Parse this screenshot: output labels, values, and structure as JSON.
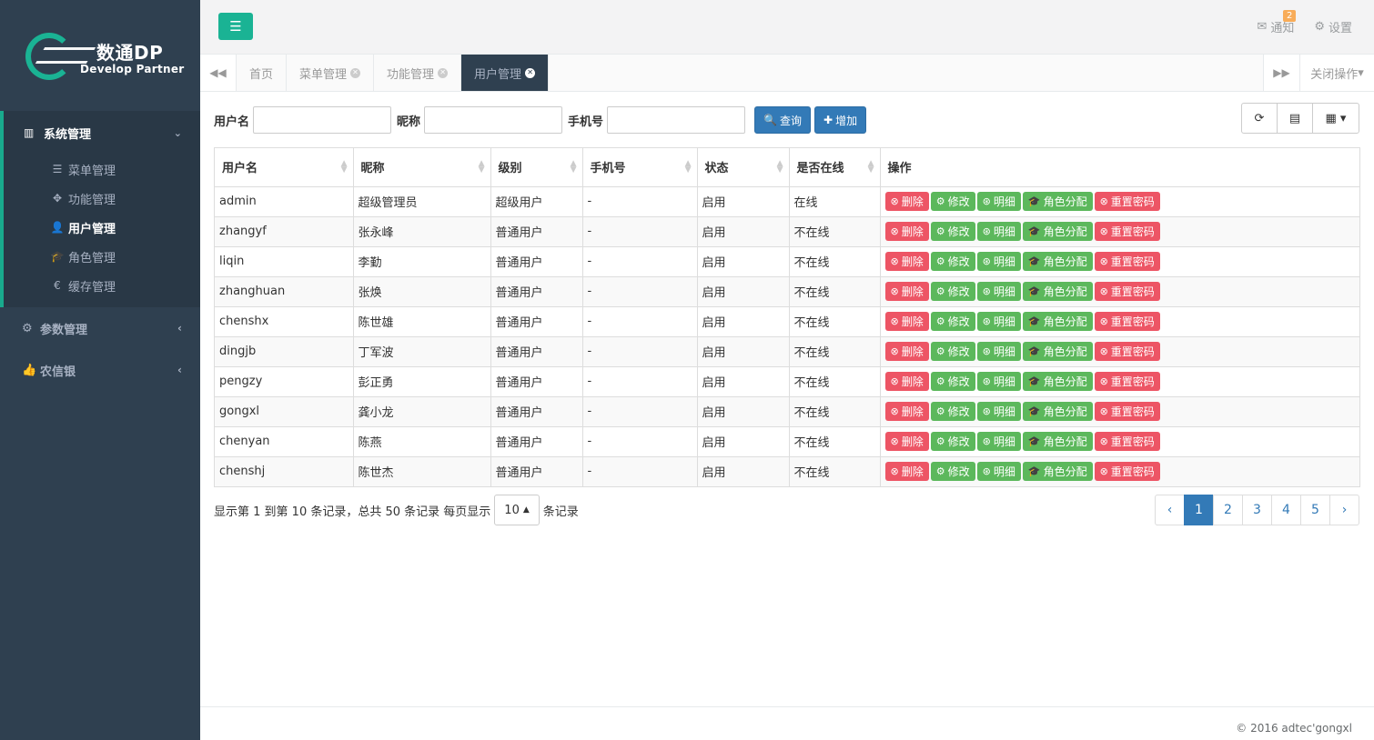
{
  "brand": {
    "title": "数通DP",
    "subtitle": "Develop Partner"
  },
  "sidebar": {
    "system": {
      "label": "系统管理",
      "items": [
        {
          "label": "菜单管理",
          "icon": "list-icon"
        },
        {
          "label": "功能管理",
          "icon": "puzzle-icon"
        },
        {
          "label": "用户管理",
          "icon": "user-icon"
        },
        {
          "label": "角色管理",
          "icon": "graduation-cap-icon"
        },
        {
          "label": "缓存管理",
          "icon": "euro-icon"
        }
      ]
    },
    "params": {
      "label": "参数管理"
    },
    "nongxin": {
      "label": "农信银"
    }
  },
  "topbar": {
    "notify_label": "通知",
    "notify_count": "2",
    "settings_label": "设置"
  },
  "tabs": {
    "items": [
      "首页",
      "菜单管理",
      "功能管理",
      "用户管理"
    ],
    "close_ops": "关闭操作"
  },
  "search": {
    "username_label": "用户名",
    "nickname_label": "昵称",
    "phone_label": "手机号",
    "query_label": "查询",
    "add_label": "增加"
  },
  "table": {
    "columns": [
      "用户名",
      "昵称",
      "级别",
      "手机号",
      "状态",
      "是否在线",
      "操作"
    ],
    "actions": [
      "删除",
      "修改",
      "明细",
      "角色分配",
      "重置密码"
    ],
    "rows": [
      [
        "admin",
        "超级管理员",
        "超级用户",
        "-",
        "启用",
        "在线"
      ],
      [
        "zhangyf",
        "张永峰",
        "普通用户",
        "-",
        "启用",
        "不在线"
      ],
      [
        "liqin",
        "李勤",
        "普通用户",
        "-",
        "启用",
        "不在线"
      ],
      [
        "zhanghuan",
        "张焕",
        "普通用户",
        "-",
        "启用",
        "不在线"
      ],
      [
        "chenshx",
        "陈世雄",
        "普通用户",
        "-",
        "启用",
        "不在线"
      ],
      [
        "dingjb",
        "丁军波",
        "普通用户",
        "-",
        "启用",
        "不在线"
      ],
      [
        "pengzy",
        "彭正勇",
        "普通用户",
        "-",
        "启用",
        "不在线"
      ],
      [
        "gongxl",
        "龚小龙",
        "普通用户",
        "-",
        "启用",
        "不在线"
      ],
      [
        "chenyan",
        "陈燕",
        "普通用户",
        "-",
        "启用",
        "不在线"
      ],
      [
        "chenshj",
        "陈世杰",
        "普通用户",
        "-",
        "启用",
        "不在线"
      ]
    ]
  },
  "pagination": {
    "info": "显示第 1 到第 10 条记录，总共 50 条记录 每页显示",
    "page_size": "10",
    "suffix": "条记录",
    "prev": "‹",
    "next": "›",
    "pages": [
      "1",
      "2",
      "3",
      "4",
      "5"
    ],
    "current": "1"
  },
  "footer": {
    "copyright": "© 2016 adtec'gongxl"
  },
  "colors": {
    "sidebar": "#2f4050",
    "accent": "#1ab394",
    "primary": "#337ab7",
    "danger": "#ed5565",
    "success": "#5cb85c"
  }
}
